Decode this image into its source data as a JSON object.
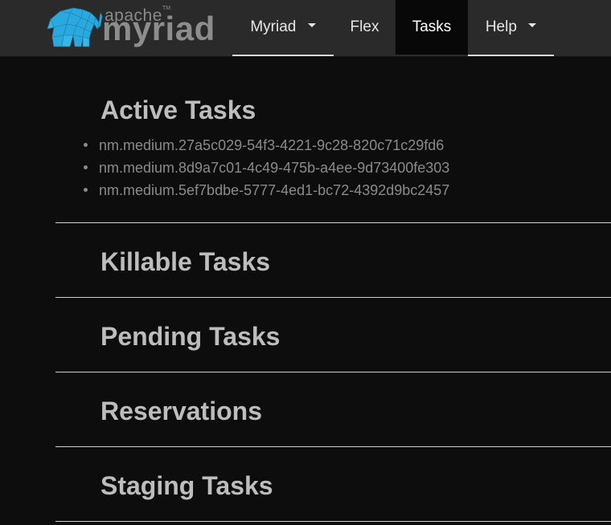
{
  "brand": {
    "apache": "apache",
    "tm": "TM",
    "name": "myriad",
    "logo_icon": "elephant-icon",
    "logo_color": "#29a9dd"
  },
  "nav": {
    "items": [
      {
        "label": "Myriad",
        "dropdown": true
      },
      {
        "label": "Flex",
        "dropdown": false
      },
      {
        "label": "Tasks",
        "dropdown": false,
        "active": true
      },
      {
        "label": "Help",
        "dropdown": true
      }
    ]
  },
  "sections": {
    "active": {
      "title": "Active Tasks",
      "tasks": [
        "nm.medium.27a5c029-54f3-4221-9c28-820c71c29fd6",
        "nm.medium.8d9a7c01-4c49-475b-a4ee-9d73400fe303",
        "nm.medium.5ef7bdbe-5777-4ed1-bc72-4392d9bc2457"
      ]
    },
    "killable": {
      "title": "Killable Tasks"
    },
    "pending": {
      "title": "Pending Tasks"
    },
    "reservations": {
      "title": "Reservations"
    },
    "staging": {
      "title": "Staging Tasks"
    }
  },
  "colors": {
    "navbar_bg": "#2a2a2a",
    "page_bg": "#0d0d0d",
    "heading": "#bdbdbd",
    "task_text": "#8a8a8a"
  }
}
